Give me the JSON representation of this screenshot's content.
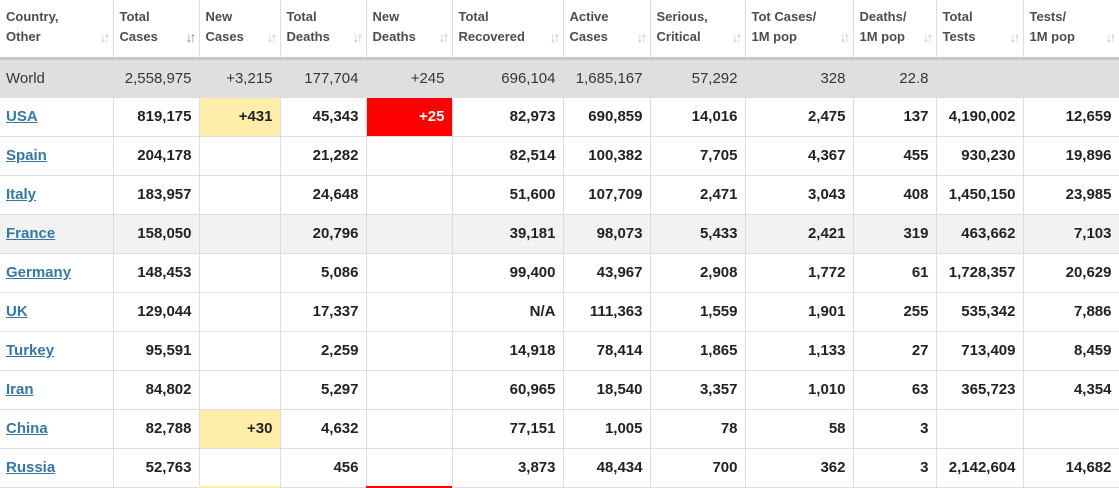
{
  "colors": {
    "new_cases_bg": "#ffeeaa",
    "new_deaths_bg": "#ff0000",
    "link": "#3478a7",
    "world_row_bg": "#dfdfdf",
    "alt_row_bg": "#f2f2f2"
  },
  "header": [
    {
      "l1": "Country,",
      "l2": "Other"
    },
    {
      "l1": "Total",
      "l2": "Cases",
      "sort": "active"
    },
    {
      "l1": "New",
      "l2": "Cases"
    },
    {
      "l1": "Total",
      "l2": "Deaths"
    },
    {
      "l1": "New",
      "l2": "Deaths"
    },
    {
      "l1": "Total",
      "l2": "Recovered"
    },
    {
      "l1": "Active",
      "l2": "Cases"
    },
    {
      "l1": "Serious,",
      "l2": "Critical"
    },
    {
      "l1": "Tot Cases/",
      "l2": "1M pop"
    },
    {
      "l1": "Deaths/",
      "l2": "1M pop"
    },
    {
      "l1": "Total",
      "l2": "Tests"
    },
    {
      "l1": "Tests/",
      "l2": "1M pop"
    }
  ],
  "rows": [
    {
      "country": "World",
      "is_world": true,
      "total_cases": "2,558,975",
      "new_cases": "+3,215",
      "total_deaths": "177,704",
      "new_deaths": "+245",
      "total_recovered": "696,104",
      "active_cases": "1,685,167",
      "serious_critical": "57,292",
      "cases_per_1m": "328",
      "deaths_per_1m": "22.8",
      "total_tests": "",
      "tests_per_1m": ""
    },
    {
      "country": "USA",
      "total_cases": "819,175",
      "new_cases": "+431",
      "total_deaths": "45,343",
      "new_deaths": "+25",
      "total_recovered": "82,973",
      "active_cases": "690,859",
      "serious_critical": "14,016",
      "cases_per_1m": "2,475",
      "deaths_per_1m": "137",
      "total_tests": "4,190,002",
      "tests_per_1m": "12,659"
    },
    {
      "country": "Spain",
      "total_cases": "204,178",
      "new_cases": "",
      "total_deaths": "21,282",
      "new_deaths": "",
      "total_recovered": "82,514",
      "active_cases": "100,382",
      "serious_critical": "7,705",
      "cases_per_1m": "4,367",
      "deaths_per_1m": "455",
      "total_tests": "930,230",
      "tests_per_1m": "19,896"
    },
    {
      "country": "Italy",
      "total_cases": "183,957",
      "new_cases": "",
      "total_deaths": "24,648",
      "new_deaths": "",
      "total_recovered": "51,600",
      "active_cases": "107,709",
      "serious_critical": "2,471",
      "cases_per_1m": "3,043",
      "deaths_per_1m": "408",
      "total_tests": "1,450,150",
      "tests_per_1m": "23,985"
    },
    {
      "country": "France",
      "total_cases": "158,050",
      "new_cases": "",
      "total_deaths": "20,796",
      "new_deaths": "",
      "total_recovered": "39,181",
      "active_cases": "98,073",
      "serious_critical": "5,433",
      "cases_per_1m": "2,421",
      "deaths_per_1m": "319",
      "total_tests": "463,662",
      "tests_per_1m": "7,103"
    },
    {
      "country": "Germany",
      "total_cases": "148,453",
      "new_cases": "",
      "total_deaths": "5,086",
      "new_deaths": "",
      "total_recovered": "99,400",
      "active_cases": "43,967",
      "serious_critical": "2,908",
      "cases_per_1m": "1,772",
      "deaths_per_1m": "61",
      "total_tests": "1,728,357",
      "tests_per_1m": "20,629"
    },
    {
      "country": "UK",
      "total_cases": "129,044",
      "new_cases": "",
      "total_deaths": "17,337",
      "new_deaths": "",
      "total_recovered": "N/A",
      "active_cases": "111,363",
      "serious_critical": "1,559",
      "cases_per_1m": "1,901",
      "deaths_per_1m": "255",
      "total_tests": "535,342",
      "tests_per_1m": "7,886"
    },
    {
      "country": "Turkey",
      "total_cases": "95,591",
      "new_cases": "",
      "total_deaths": "2,259",
      "new_deaths": "",
      "total_recovered": "14,918",
      "active_cases": "78,414",
      "serious_critical": "1,865",
      "cases_per_1m": "1,133",
      "deaths_per_1m": "27",
      "total_tests": "713,409",
      "tests_per_1m": "8,459"
    },
    {
      "country": "Iran",
      "total_cases": "84,802",
      "new_cases": "",
      "total_deaths": "5,297",
      "new_deaths": "",
      "total_recovered": "60,965",
      "active_cases": "18,540",
      "serious_critical": "3,357",
      "cases_per_1m": "1,010",
      "deaths_per_1m": "63",
      "total_tests": "365,723",
      "tests_per_1m": "4,354"
    },
    {
      "country": "China",
      "total_cases": "82,788",
      "new_cases": "+30",
      "total_deaths": "4,632",
      "new_deaths": "",
      "total_recovered": "77,151",
      "active_cases": "1,005",
      "serious_critical": "78",
      "cases_per_1m": "58",
      "deaths_per_1m": "3",
      "total_tests": "",
      "tests_per_1m": ""
    },
    {
      "country": "Russia",
      "total_cases": "52,763",
      "new_cases": "",
      "total_deaths": "456",
      "new_deaths": "",
      "total_recovered": "3,873",
      "active_cases": "48,434",
      "serious_critical": "700",
      "cases_per_1m": "362",
      "deaths_per_1m": "3",
      "total_tests": "2,142,604",
      "tests_per_1m": "14,682"
    }
  ]
}
